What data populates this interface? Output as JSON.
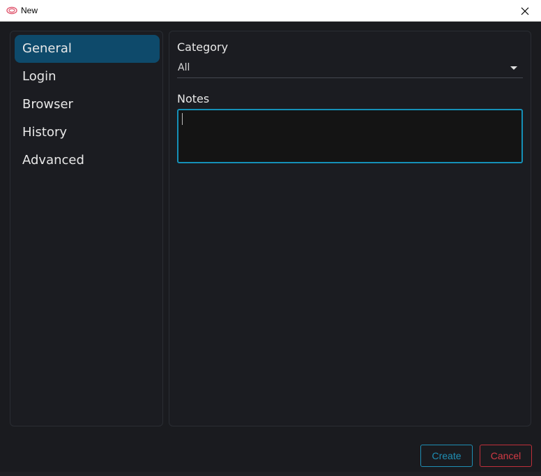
{
  "window": {
    "title": "New",
    "close_glyph": "✕",
    "app_icon": "app-logo-icon"
  },
  "sidebar": {
    "items": [
      {
        "label": "General",
        "active": true
      },
      {
        "label": "Login",
        "active": false
      },
      {
        "label": "Browser",
        "active": false
      },
      {
        "label": "History",
        "active": false
      },
      {
        "label": "Advanced",
        "active": false
      }
    ]
  },
  "form": {
    "category_label": "Category",
    "category_value": "All",
    "notes_label": "Notes",
    "notes_value": ""
  },
  "footer": {
    "create_label": "Create",
    "cancel_label": "Cancel"
  },
  "colors": {
    "active_nav": "#0e4a6b",
    "focus_border": "#1590b8",
    "create_accent": "#1f8fb5",
    "cancel_accent": "#d23a44"
  }
}
